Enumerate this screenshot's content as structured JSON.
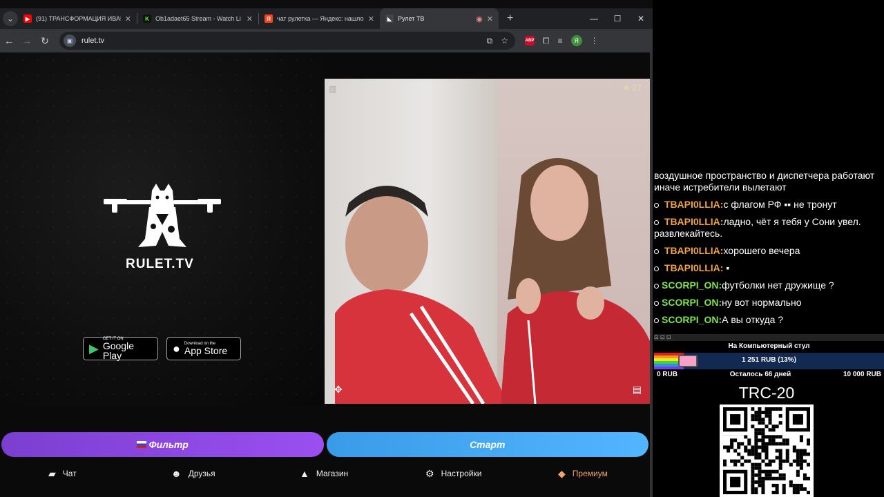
{
  "tabs": [
    {
      "title": "(91) ТРАНСФОРМАЦИЯ ИВАН",
      "favicon": "youtube-icon",
      "color": "#ff0000"
    },
    {
      "title": "Ob1adaet65 Stream - Watch Li",
      "favicon": "kick-icon",
      "color": "#53fc18"
    },
    {
      "title": "чат рулетка — Яндекс: нашлос",
      "favicon": "yandex-icon",
      "color": "#fc3f1d"
    },
    {
      "title": "Рулет ТВ",
      "favicon": "rulet-icon",
      "color": "#222222"
    }
  ],
  "address": {
    "url": "rulet.tv"
  },
  "page": {
    "brand": "RULET.TV",
    "google_play": {
      "small": "GET IT ON",
      "big": "Google Play"
    },
    "app_store": {
      "small": "Download on the",
      "big": "App Store"
    },
    "rating": "27",
    "filter_label": "Фильтр",
    "start_label": "Старт",
    "nav": {
      "chat": "Чат",
      "friends": "Друзья",
      "shop": "Магазин",
      "settings": "Настройки",
      "premium": "Премиум"
    }
  },
  "overlay": {
    "chat_messages": [
      {
        "user": "",
        "text": "воздушное пространство и диспетчера работают иначе истребители вылетают"
      },
      {
        "user": "TBAPI0LLIA:",
        "text": "с флагом РФ ▪▪ не тронут"
      },
      {
        "user": "TBAPI0LLIA:",
        "text": "ладно, чёт я тебя у Сони увел. развлекайтесь."
      },
      {
        "user": "TBAPI0LLIA:",
        "text": "хорошего вечера"
      },
      {
        "user": "TBAPI0LLIA:",
        "text": "▪"
      },
      {
        "user": "SCORPI_ON:",
        "text": "футболки нет дружище ?"
      },
      {
        "user": "SCORPI_ON:",
        "text": "ну вот нормально"
      },
      {
        "user": "SCORPI_ON:",
        "text": "А вы откуда ?"
      }
    ],
    "donation": {
      "title": "На Компьютерный стул",
      "amount": "1 251 RUB (13%)",
      "progress": 0.13,
      "min": "0 RUB",
      "remaining": "Осталось 66 дней",
      "max": "10 000 RUB"
    },
    "trc_label": "TRC-20"
  }
}
